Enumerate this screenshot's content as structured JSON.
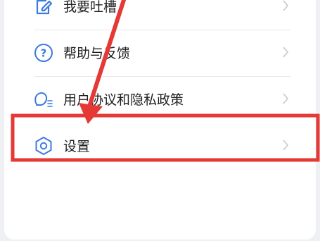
{
  "menu": {
    "items": [
      {
        "label": "我要吐槽",
        "icon": "edit-note-icon"
      },
      {
        "label": "帮助与反馈",
        "icon": "help-circle-icon"
      },
      {
        "label": "用户协议和隐私政策",
        "icon": "privacy-key-icon"
      },
      {
        "label": "设置",
        "icon": "settings-hexagon-icon",
        "highlighted": true
      }
    ]
  },
  "colors": {
    "icon_accent": "#3b7be0",
    "annotation_red": "#e53935",
    "chevron": "#c8c8cc",
    "text": "#1f1f1f"
  }
}
